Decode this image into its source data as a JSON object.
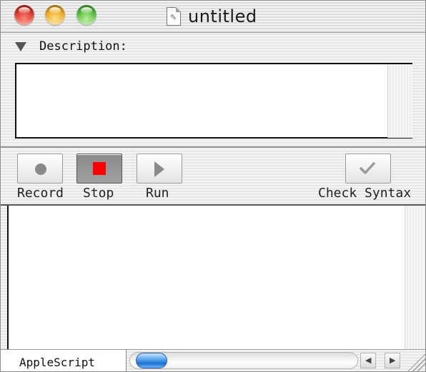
{
  "window": {
    "title": "untitled",
    "doc_icon_glyph": "✎"
  },
  "description": {
    "label": "Description:",
    "text": ""
  },
  "toolbar": {
    "record_label": "Record",
    "stop_label": "Stop",
    "run_label": "Run",
    "check_label": "Check Syntax",
    "stop_color": "#ff0000"
  },
  "editor": {
    "text": ""
  },
  "bottom": {
    "language": "AppleScript",
    "left_arrow": "◀",
    "right_arrow": "▶"
  },
  "icons": {
    "close": "close-icon",
    "minimize": "minimize-icon",
    "zoom": "zoom-icon",
    "disclosure": "disclosure-triangle-icon",
    "record": "record-dot-icon",
    "stop": "stop-square-icon",
    "run": "play-triangle-icon",
    "check": "checkmark-icon",
    "grow": "resize-grip-icon"
  }
}
